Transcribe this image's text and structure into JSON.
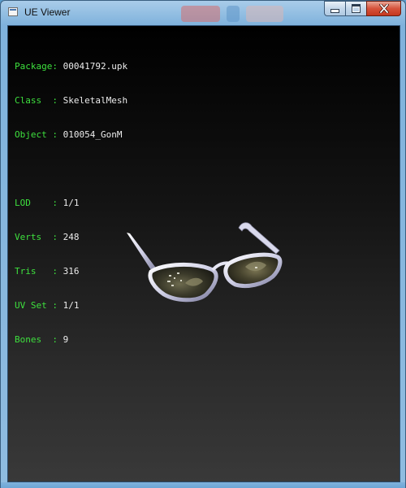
{
  "window": {
    "title": "UE Viewer",
    "minimize_label": "",
    "maximize_label": "",
    "close_label": "✕"
  },
  "info": {
    "package": {
      "label": "Package:",
      "value": "00041792.upk"
    },
    "class": {
      "label": "Class  :",
      "value": "SkeletalMesh"
    },
    "object": {
      "label": "Object :",
      "value": "010054_GonM"
    },
    "lod": {
      "label": "LOD    :",
      "value": "1/1"
    },
    "verts": {
      "label": "Verts  :",
      "value": "248"
    },
    "tris": {
      "label": "Tris   :",
      "value": "316"
    },
    "uvset": {
      "label": "UV Set :",
      "value": "1/1"
    },
    "bones": {
      "label": "Bones  :",
      "value": "9"
    }
  },
  "colors": {
    "label": "#3ee03e",
    "value": "#ececec",
    "viewport_top": "#000000",
    "viewport_bottom": "#393939"
  },
  "icons": {
    "app": "app-window-icon",
    "minimize": "minimize-icon",
    "maximize": "maximize-icon",
    "close": "close-icon",
    "model": "sunglasses-3d-model"
  }
}
